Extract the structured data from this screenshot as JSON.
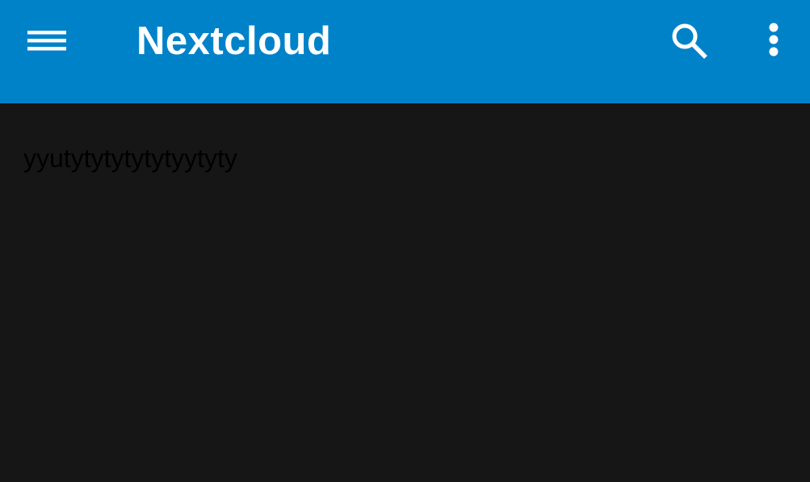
{
  "app_bar": {
    "title": "Nextcloud",
    "background_color": "#0082c9",
    "menu_icon": "hamburger-menu-icon",
    "search_icon": "search-icon",
    "more_icon": "more-vertical-icon"
  },
  "content": {
    "background_color": "#161616",
    "text": "yyutytytytytytyytyty"
  }
}
